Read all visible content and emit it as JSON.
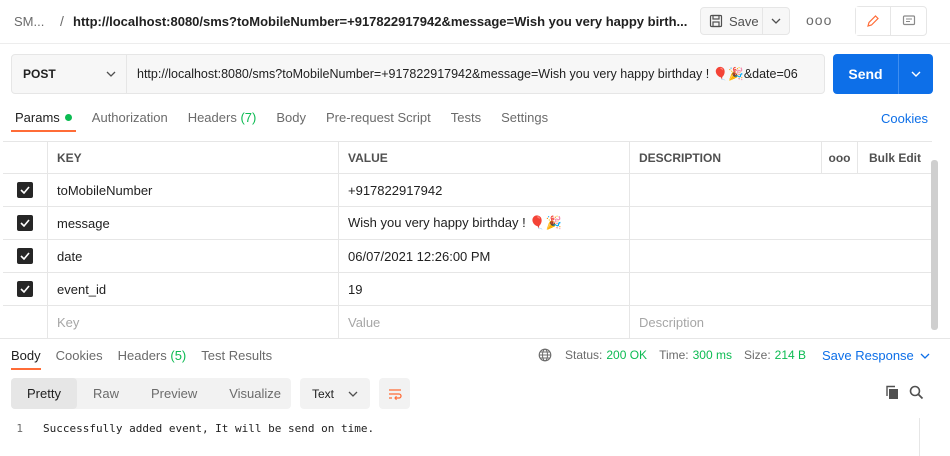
{
  "header": {
    "collection": "SM...",
    "separator": "/",
    "request_title": "http://localhost:8080/sms?toMobileNumber=+917822917942&message=Wish you very happy birth...",
    "save_label": "Save",
    "more_label": "ooo"
  },
  "request": {
    "method": "POST",
    "url": "http://localhost:8080/sms?toMobileNumber=+917822917942&message=Wish you very happy birthday ! 🎈🎉&date=06",
    "send_label": "Send"
  },
  "tabs": [
    {
      "label": "Params"
    },
    {
      "label": "Authorization"
    },
    {
      "label": "Headers",
      "count": "(7)"
    },
    {
      "label": "Body"
    },
    {
      "label": "Pre-request Script"
    },
    {
      "label": "Tests"
    },
    {
      "label": "Settings"
    }
  ],
  "cookies_label": "Cookies",
  "params": {
    "headers": {
      "key": "KEY",
      "value": "VALUE",
      "description": "DESCRIPTION",
      "more": "ooo",
      "bulk": "Bulk Edit"
    },
    "rows": [
      {
        "key": "toMobileNumber",
        "value": "+917822917942",
        "checked": true
      },
      {
        "key": "message",
        "value": "Wish you very happy birthday ! 🎈🎉",
        "checked": true
      },
      {
        "key": "date",
        "value": "06/07/2021 12:26:00 PM",
        "checked": true
      },
      {
        "key": "event_id",
        "value": "19",
        "checked": true
      }
    ],
    "placeholders": {
      "key": "Key",
      "value": "Value",
      "description": "Description"
    }
  },
  "response": {
    "tabs": [
      {
        "label": "Body"
      },
      {
        "label": "Cookies"
      },
      {
        "label": "Headers",
        "count": "(5)"
      },
      {
        "label": "Test Results"
      }
    ],
    "status_label": "Status:",
    "status_value": "200 OK",
    "time_label": "Time:",
    "time_value": "300 ms",
    "size_label": "Size:",
    "size_value": "214 B",
    "save_response_label": "Save Response",
    "views": [
      "Pretty",
      "Raw",
      "Preview",
      "Visualize"
    ],
    "format": "Text",
    "line_number": "1",
    "body_text": "Successfully added event, It will be send on time."
  },
  "colors": {
    "accent_orange": "#ff6c37",
    "send_blue": "#0d6fe8",
    "status_green": "#0cbb52"
  }
}
